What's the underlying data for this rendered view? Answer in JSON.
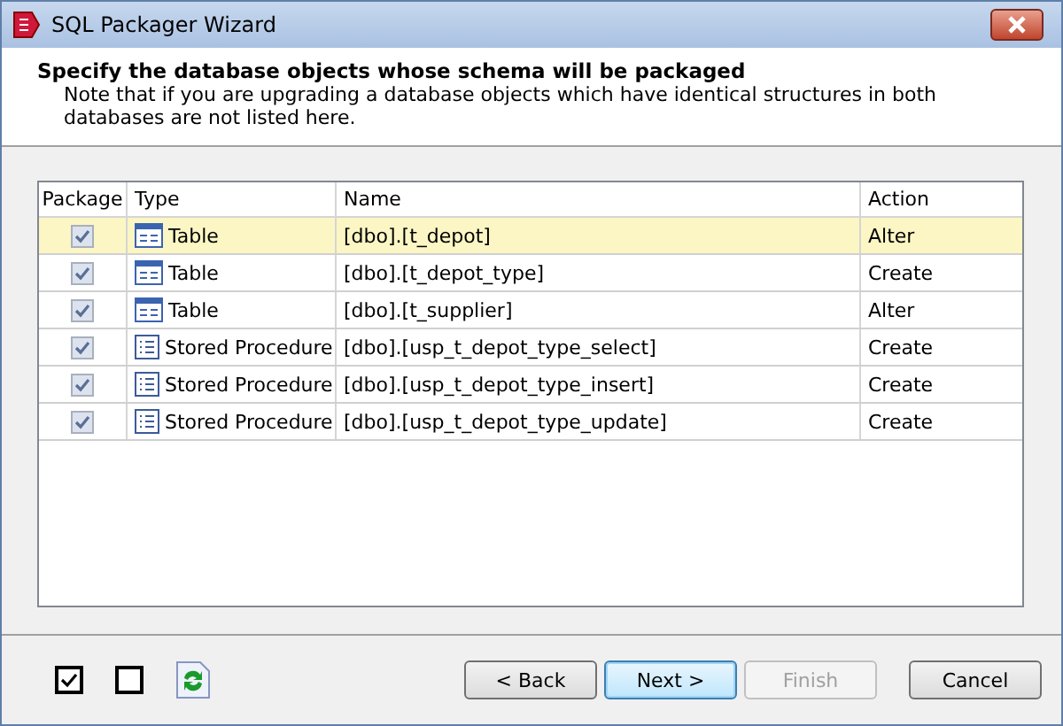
{
  "window": {
    "title": "SQL Packager Wizard"
  },
  "header": {
    "title": "Specify the database objects whose schema will be packaged",
    "note": "Note that if you are upgrading a database objects which have identical structures in both databases are not listed here."
  },
  "table": {
    "columns": [
      "Package",
      "Type",
      "Name",
      "Action"
    ],
    "rows": [
      {
        "checked": true,
        "selected": true,
        "kind": "table",
        "type": "Table",
        "name": "[dbo].[t_depot]",
        "action": "Alter"
      },
      {
        "checked": true,
        "selected": false,
        "kind": "table",
        "type": "Table",
        "name": "[dbo].[t_depot_type]",
        "action": "Create"
      },
      {
        "checked": true,
        "selected": false,
        "kind": "table",
        "type": "Table",
        "name": "[dbo].[t_supplier]",
        "action": "Alter"
      },
      {
        "checked": true,
        "selected": false,
        "kind": "procedure",
        "type": "Stored Procedure",
        "name": "[dbo].[usp_t_depot_type_select]",
        "action": "Create"
      },
      {
        "checked": true,
        "selected": false,
        "kind": "procedure",
        "type": "Stored Procedure",
        "name": "[dbo].[usp_t_depot_type_insert]",
        "action": "Create"
      },
      {
        "checked": true,
        "selected": false,
        "kind": "procedure",
        "type": "Stored Procedure",
        "name": "[dbo].[usp_t_depot_type_update]",
        "action": "Create"
      }
    ]
  },
  "buttons": [
    {
      "label": "< Back",
      "disabled": false,
      "default": false
    },
    {
      "label": "Next >",
      "disabled": false,
      "default": true
    },
    {
      "label": "Finish",
      "disabled": true,
      "default": false
    },
    {
      "label": "Cancel",
      "disabled": false,
      "default": false
    }
  ]
}
